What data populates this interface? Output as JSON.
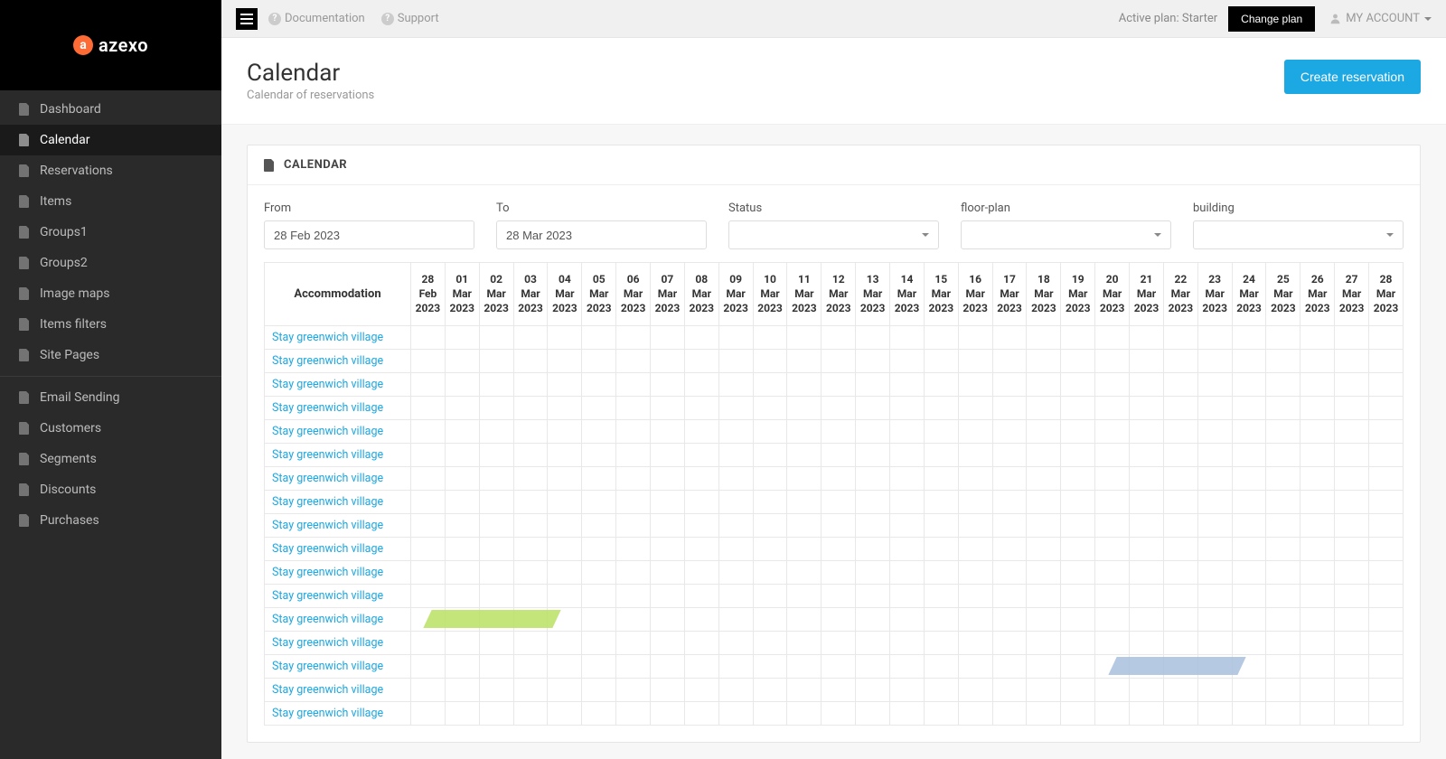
{
  "brand": {
    "name": "azexo",
    "mark": "a"
  },
  "sidebar": {
    "groups": [
      {
        "items": [
          {
            "id": "dashboard",
            "label": "Dashboard",
            "active": false
          },
          {
            "id": "calendar",
            "label": "Calendar",
            "active": true
          },
          {
            "id": "reservations",
            "label": "Reservations",
            "active": false
          },
          {
            "id": "items",
            "label": "Items",
            "active": false
          },
          {
            "id": "groups1",
            "label": "Groups1",
            "active": false
          },
          {
            "id": "groups2",
            "label": "Groups2",
            "active": false
          },
          {
            "id": "image-maps",
            "label": "Image maps",
            "active": false
          },
          {
            "id": "items-filters",
            "label": "Items filters",
            "active": false
          },
          {
            "id": "site-pages",
            "label": "Site Pages",
            "active": false
          }
        ]
      },
      {
        "items": [
          {
            "id": "email-sending",
            "label": "Email Sending",
            "active": false
          },
          {
            "id": "customers",
            "label": "Customers",
            "active": false
          },
          {
            "id": "segments",
            "label": "Segments",
            "active": false
          },
          {
            "id": "discounts",
            "label": "Discounts",
            "active": false
          },
          {
            "id": "purchases",
            "label": "Purchases",
            "active": false
          }
        ]
      }
    ]
  },
  "topbar": {
    "documentation": "Documentation",
    "support": "Support",
    "plan_label": "Active plan: Starter",
    "change_plan": "Change plan",
    "account": "MY ACCOUNT"
  },
  "page": {
    "title": "Calendar",
    "subtitle": "Calendar of reservations",
    "create_button": "Create reservation"
  },
  "panel": {
    "title": "CALENDAR"
  },
  "filters": {
    "from": {
      "label": "From",
      "value": "28 Feb 2023"
    },
    "to": {
      "label": "To",
      "value": "28 Mar 2023"
    },
    "status": {
      "label": "Status",
      "value": ""
    },
    "floor_plan": {
      "label": "floor-plan",
      "value": ""
    },
    "building": {
      "label": "building",
      "value": ""
    }
  },
  "grid": {
    "accommodation_header": "Accommodation",
    "dates": [
      {
        "d": "28",
        "m": "Feb",
        "y": "2023"
      },
      {
        "d": "01",
        "m": "Mar",
        "y": "2023"
      },
      {
        "d": "02",
        "m": "Mar",
        "y": "2023"
      },
      {
        "d": "03",
        "m": "Mar",
        "y": "2023"
      },
      {
        "d": "04",
        "m": "Mar",
        "y": "2023"
      },
      {
        "d": "05",
        "m": "Mar",
        "y": "2023"
      },
      {
        "d": "06",
        "m": "Mar",
        "y": "2023"
      },
      {
        "d": "07",
        "m": "Mar",
        "y": "2023"
      },
      {
        "d": "08",
        "m": "Mar",
        "y": "2023"
      },
      {
        "d": "09",
        "m": "Mar",
        "y": "2023"
      },
      {
        "d": "10",
        "m": "Mar",
        "y": "2023"
      },
      {
        "d": "11",
        "m": "Mar",
        "y": "2023"
      },
      {
        "d": "12",
        "m": "Mar",
        "y": "2023"
      },
      {
        "d": "13",
        "m": "Mar",
        "y": "2023"
      },
      {
        "d": "14",
        "m": "Mar",
        "y": "2023"
      },
      {
        "d": "15",
        "m": "Mar",
        "y": "2023"
      },
      {
        "d": "16",
        "m": "Mar",
        "y": "2023"
      },
      {
        "d": "17",
        "m": "Mar",
        "y": "2023"
      },
      {
        "d": "18",
        "m": "Mar",
        "y": "2023"
      },
      {
        "d": "19",
        "m": "Mar",
        "y": "2023"
      },
      {
        "d": "20",
        "m": "Mar",
        "y": "2023"
      },
      {
        "d": "21",
        "m": "Mar",
        "y": "2023"
      },
      {
        "d": "22",
        "m": "Mar",
        "y": "2023"
      },
      {
        "d": "23",
        "m": "Mar",
        "y": "2023"
      },
      {
        "d": "24",
        "m": "Mar",
        "y": "2023"
      },
      {
        "d": "25",
        "m": "Mar",
        "y": "2023"
      },
      {
        "d": "26",
        "m": "Mar",
        "y": "2023"
      },
      {
        "d": "27",
        "m": "Mar",
        "y": "2023"
      },
      {
        "d": "28",
        "m": "Mar",
        "y": "2023"
      }
    ],
    "rows": [
      {
        "name": "Stay greenwich village",
        "bars": []
      },
      {
        "name": "Stay greenwich village",
        "bars": []
      },
      {
        "name": "Stay greenwich village",
        "bars": []
      },
      {
        "name": "Stay greenwich village",
        "bars": []
      },
      {
        "name": "Stay greenwich village",
        "bars": []
      },
      {
        "name": "Stay greenwich village",
        "bars": []
      },
      {
        "name": "Stay greenwich village",
        "bars": []
      },
      {
        "name": "Stay greenwich village",
        "bars": []
      },
      {
        "name": "Stay greenwich village",
        "bars": []
      },
      {
        "name": "Stay greenwich village",
        "bars": []
      },
      {
        "name": "Stay greenwich village",
        "bars": []
      },
      {
        "name": "Stay greenwich village",
        "bars": []
      },
      {
        "name": "Stay greenwich village",
        "bars": [
          {
            "start": 0,
            "span": 4,
            "color": "green"
          }
        ]
      },
      {
        "name": "Stay greenwich village",
        "bars": []
      },
      {
        "name": "Stay greenwich village",
        "bars": [
          {
            "start": 20,
            "span": 4,
            "color": "blue"
          }
        ]
      },
      {
        "name": "Stay greenwich village",
        "bars": []
      },
      {
        "name": "Stay greenwich village",
        "bars": []
      }
    ]
  }
}
